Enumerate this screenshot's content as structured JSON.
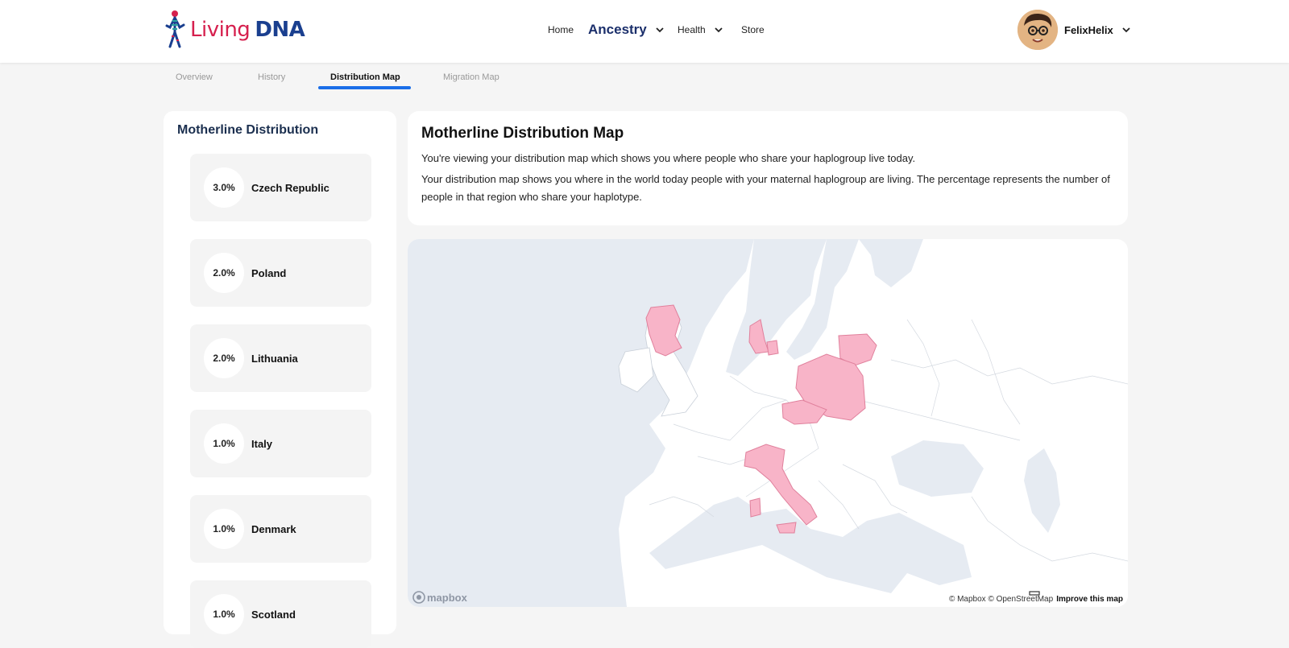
{
  "header": {
    "logo_text_1": "Living",
    "logo_text_2": "DNA",
    "nav": {
      "home": "Home",
      "ancestry": "Ancestry",
      "health": "Health",
      "store": "Store"
    },
    "user_name": "FelixHelix"
  },
  "tabs": [
    "Overview",
    "History",
    "Distribution Map",
    "Migration Map"
  ],
  "active_tab": "Distribution Map",
  "sidebar": {
    "title": "Motherline Distribution",
    "items": [
      {
        "percent": "3.0%",
        "country": "Czech Republic"
      },
      {
        "percent": "2.0%",
        "country": "Poland"
      },
      {
        "percent": "2.0%",
        "country": "Lithuania"
      },
      {
        "percent": "1.0%",
        "country": "Italy"
      },
      {
        "percent": "1.0%",
        "country": "Denmark"
      },
      {
        "percent": "1.0%",
        "country": "Scotland"
      }
    ]
  },
  "info": {
    "title": "Motherline Distribution Map",
    "p1": "You're viewing your distribution map which shows you where people who share your haplogroup live today.",
    "p2": "Your distribution map shows you where in the world today people with your maternal haplogroup are living. The percentage represents the number of people in that region who share your haplotype."
  },
  "map": {
    "logo": "mapbox",
    "attribution": "© Mapbox © OpenStreetMap",
    "improve": "Improve this map",
    "colors": {
      "sea": "#e6ebf2",
      "land": "#ffffff",
      "highlight": "#f8b4c8",
      "highlight_border": "#e0809c"
    }
  }
}
